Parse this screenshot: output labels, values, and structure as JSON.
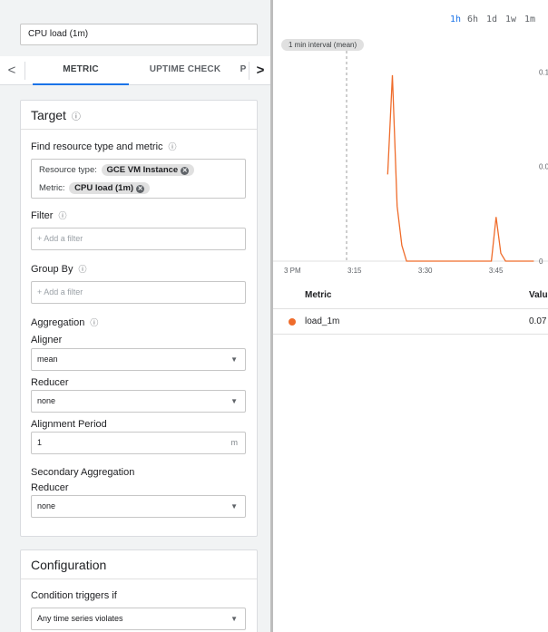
{
  "condition_title": "CPU load (1m)",
  "tabs": {
    "prev_arrow": "<",
    "next_arrow": ">",
    "items": [
      "METRIC",
      "UPTIME CHECK",
      "P"
    ]
  },
  "target": {
    "title": "Target",
    "help_icon": "?",
    "find_label": "Find resource type and metric",
    "resource_type_label": "Resource type:",
    "resource_type_value": "GCE VM Instance",
    "metric_label": "Metric:",
    "metric_value": "CPU load (1m)",
    "filter_label": "Filter",
    "filter_placeholder": "+ Add a filter",
    "group_by_label": "Group By",
    "group_by_placeholder": "+ Add a filter",
    "aggregation_label": "Aggregation",
    "aligner_label": "Aligner",
    "aligner_value": "mean",
    "reducer_label": "Reducer",
    "reducer_value": "none",
    "alignment_period_label": "Alignment Period",
    "alignment_period_value": "1",
    "alignment_period_unit": "m",
    "secondary_aggregation_label": "Secondary Aggregation",
    "secondary_reducer_label": "Reducer",
    "secondary_reducer_value": "none"
  },
  "configuration": {
    "title": "Configuration",
    "condition_triggers_label": "Condition triggers if",
    "condition_triggers_value": "Any time series violates"
  },
  "time_ranges": [
    "1h",
    "6h",
    "1d",
    "1w",
    "1m"
  ],
  "selected_range": "1h",
  "interval_label": "1 min interval (mean)",
  "chart_data": {
    "type": "line",
    "x_ticks": [
      "3 PM",
      "3:15",
      "3:30",
      "3:45"
    ],
    "y_ticks": [
      "0.1",
      "0.0",
      "0"
    ],
    "series": [
      {
        "name": "load_1m",
        "color": "#ef6c2b",
        "points": [
          [
            "3:22",
            0.055
          ],
          [
            "3:23",
            0.118
          ],
          [
            "3:24",
            0.035
          ],
          [
            "3:25",
            0.01
          ],
          [
            "3:26",
            0
          ],
          [
            "3:30",
            0
          ],
          [
            "3:35",
            0
          ],
          [
            "3:40",
            0
          ],
          [
            "3:44",
            0
          ],
          [
            "3:45",
            0.028
          ],
          [
            "3:46",
            0.005
          ],
          [
            "3:47",
            0
          ],
          [
            "3:50",
            0
          ],
          [
            "3:53",
            0
          ]
        ]
      }
    ],
    "ylim": [
      0,
      0.13
    ]
  },
  "table": {
    "metric_header": "Metric",
    "value_header": "Valu",
    "rows": [
      {
        "metric": "load_1m",
        "value": "0.07"
      }
    ]
  }
}
